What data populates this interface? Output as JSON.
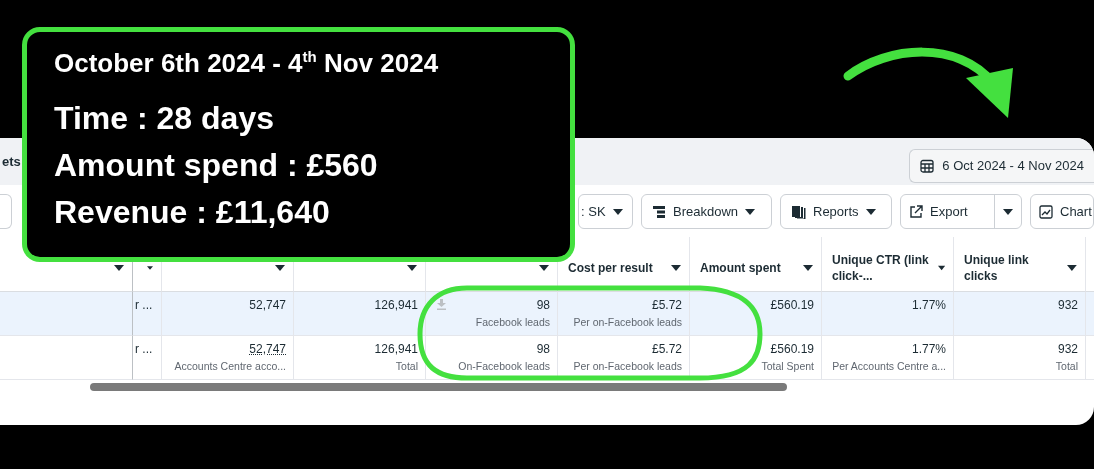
{
  "annotation": {
    "title": "October 6th 2024 - 4$^{th}$ Nov 2024",
    "lines": [
      "Time : 28 days",
      "Amount spend : £560",
      "Revenue : £11,640"
    ]
  },
  "top_bar": {
    "left_text": "ets",
    "date_range": "6 Oct 2024 - 4 Nov 2024"
  },
  "toolbar": [
    {
      "kind": "dropdown",
      "label": ": SK"
    },
    {
      "kind": "dropdown",
      "label": "Breakdown"
    },
    {
      "kind": "dropdown",
      "label": "Reports"
    },
    {
      "kind": "split",
      "label": "Export"
    },
    {
      "kind": "button",
      "label": "Chart"
    }
  ],
  "table": {
    "columns": [
      "",
      "",
      "",
      "",
      "Cost per result",
      "Amount spent",
      "Unique CTR (link click-...",
      "Unique link clicks"
    ],
    "rows": [
      {
        "selected": true,
        "cells": [
          {
            "value": "r ..."
          },
          {
            "value": "52,747"
          },
          {
            "value": "126,941"
          },
          {
            "value": "98",
            "sub": "Facebook leads"
          },
          {
            "value": "£5.72",
            "sub": "Per on-Facebook leads"
          },
          {
            "value": "£560.19"
          },
          {
            "value": "1.77%"
          },
          {
            "value": "932"
          }
        ]
      },
      {
        "selected": false,
        "cells": [
          {
            "value": "r ..."
          },
          {
            "value": "52,747",
            "sub": "Accounts Centre acco..."
          },
          {
            "value": "126,941",
            "sub": "Total"
          },
          {
            "value": "98",
            "sub": "On-Facebook leads"
          },
          {
            "value": "£5.72",
            "sub": "Per on-Facebook leads"
          },
          {
            "value": "£560.19",
            "sub": "Total Spent"
          },
          {
            "value": "1.77%",
            "sub": "Per Accounts Centre a..."
          },
          {
            "value": "932",
            "sub": "Total"
          }
        ]
      }
    ]
  }
}
